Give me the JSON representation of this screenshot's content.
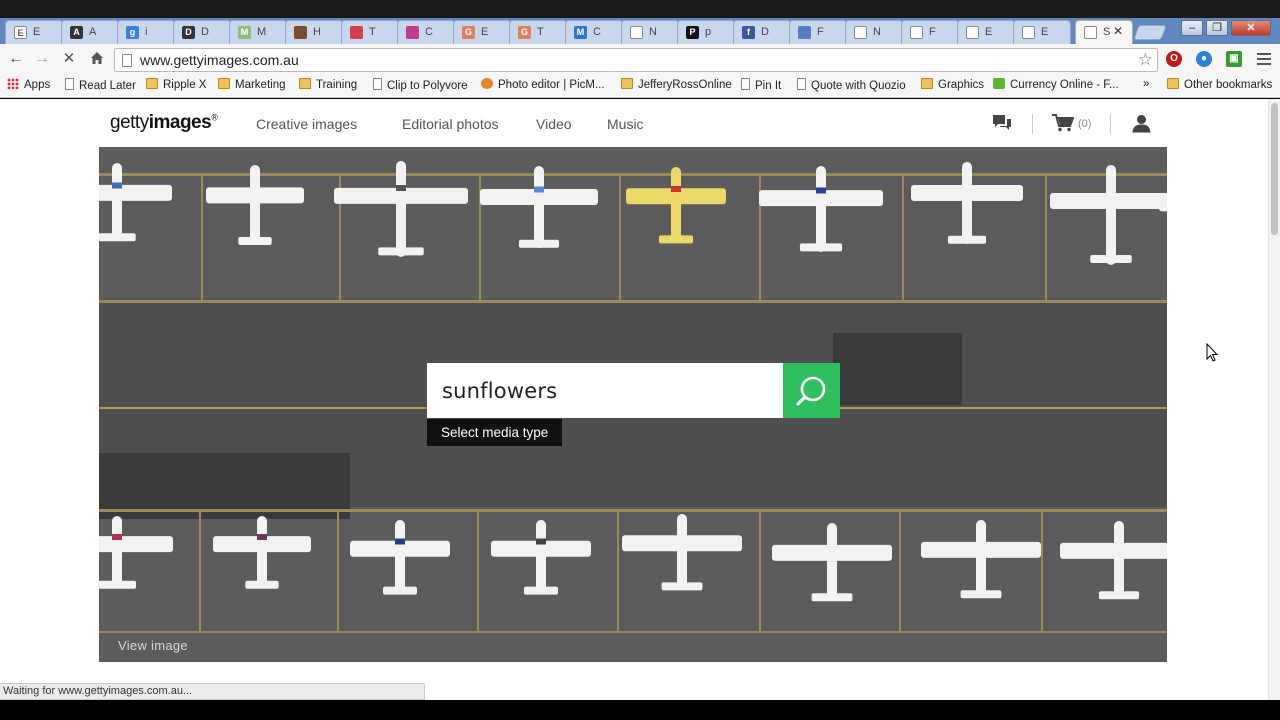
{
  "browser": {
    "tabs": [
      {
        "fav": "E",
        "favcolor": "#ffffff",
        "favtext": "#666666",
        "label": "E"
      },
      {
        "fav": "A",
        "favcolor": "#333333",
        "favtext": "#ffffff",
        "label": "A"
      },
      {
        "fav": "g",
        "favcolor": "#3b7de0",
        "favtext": "#ffffff",
        "label": "i"
      },
      {
        "fav": "D",
        "favcolor": "#333333",
        "favtext": "#ffffff",
        "label": "D"
      },
      {
        "fav": "M",
        "favcolor": "#8ac07a",
        "favtext": "#ffffff",
        "label": "M"
      },
      {
        "fav": "",
        "favcolor": "#7a4b2d",
        "favtext": "#ffffff",
        "label": "H"
      },
      {
        "fav": "",
        "favcolor": "#d04050",
        "favtext": "#ffffff",
        "label": "T"
      },
      {
        "fav": "",
        "favcolor": "#c03a90",
        "favtext": "#ffffff",
        "label": "C"
      },
      {
        "fav": "G",
        "favcolor": "#e08060",
        "favtext": "#ffffff",
        "label": "E"
      },
      {
        "fav": "G",
        "favcolor": "#e08060",
        "favtext": "#ffffff",
        "label": "T"
      },
      {
        "fav": "M",
        "favcolor": "#2d77c9",
        "favtext": "#ffffff",
        "label": "C"
      },
      {
        "fav": "",
        "favcolor": "#ffffff",
        "favtext": "#666666",
        "label": "N"
      },
      {
        "fav": "P",
        "favcolor": "#111111",
        "favtext": "#ffffff",
        "label": "p"
      },
      {
        "fav": "f",
        "favcolor": "#3b5998",
        "favtext": "#ffffff",
        "label": "D"
      },
      {
        "fav": "",
        "favcolor": "#5580c0",
        "favtext": "#ffffff",
        "label": "F"
      },
      {
        "fav": "",
        "favcolor": "#ffffff",
        "favtext": "#666666",
        "label": "N"
      },
      {
        "fav": "",
        "favcolor": "#ffffff",
        "favtext": "#666666",
        "label": "F"
      },
      {
        "fav": "",
        "favcolor": "#ffffff",
        "favtext": "#666666",
        "label": "E"
      },
      {
        "fav": "",
        "favcolor": "#ffffff",
        "favtext": "#666666",
        "label": "E"
      },
      {
        "fav": "",
        "favcolor": "#ffffff",
        "favtext": "#666666",
        "label": "S"
      }
    ],
    "url": "www.gettyimages.com.au",
    "status": "Waiting for www.gettyimages.com.au...",
    "bookmarks": [
      {
        "label": "Apps",
        "icon": "apps"
      },
      {
        "label": "Read Later",
        "icon": "page"
      },
      {
        "label": "Ripple X",
        "icon": "folder"
      },
      {
        "label": "Marketing",
        "icon": "folder"
      },
      {
        "label": "Training",
        "icon": "folder"
      },
      {
        "label": "Clip to Polyvore",
        "icon": "page"
      },
      {
        "label": "Photo editor | PicM...",
        "icon": "orange"
      },
      {
        "label": "JefferyRossOnline",
        "icon": "folder"
      },
      {
        "label": "Pin It",
        "icon": "page"
      },
      {
        "label": "Quote with Quozio",
        "icon": "page"
      },
      {
        "label": "Graphics",
        "icon": "folder"
      },
      {
        "label": "Currency Online - F...",
        "icon": "green"
      }
    ],
    "bookmarks_overflow": "»",
    "other_bookmarks": "Other bookmarks"
  },
  "site": {
    "logo_light": "getty",
    "logo_bold": "images",
    "logo_mark": "®",
    "nav": [
      "Creative images",
      "Editorial photos",
      "Video",
      "Music"
    ],
    "cart_count": "(0)",
    "search": {
      "value": "sunflowers",
      "media_type_label": "Select media type"
    },
    "view_image_label": "View image"
  },
  "colors": {
    "search_button": "#2fbf5f",
    "tarmac": "#5c5c5c"
  }
}
